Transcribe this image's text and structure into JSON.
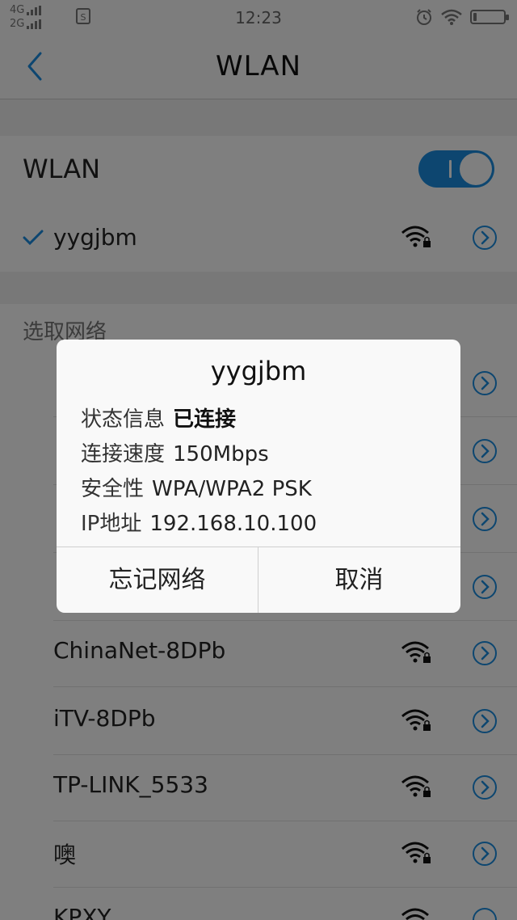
{
  "status_bar": {
    "network_top": "4G",
    "network_bottom": "2G",
    "sim_label": "S",
    "time": "12:23",
    "battery_level_pct": 10,
    "icons": [
      "alarm-icon",
      "wifi-icon",
      "battery-icon"
    ]
  },
  "nav": {
    "title": "WLAN",
    "back_icon": "chevron-left-icon"
  },
  "wlan_toggle": {
    "label": "WLAN",
    "on": true,
    "accent": "#1a8de0"
  },
  "connected": {
    "name": "yygjbm"
  },
  "section_label": "选取网络",
  "networks": [
    {
      "name": "ChinaNet-8DPb"
    },
    {
      "name": "iTV-8DPb"
    },
    {
      "name": "TP-LINK_5533"
    },
    {
      "name": "噢"
    },
    {
      "name": "KPXY"
    }
  ],
  "dialog": {
    "title": "yygjbm",
    "rows": [
      {
        "key": "状态信息",
        "value": "已连接"
      },
      {
        "key": "连接速度",
        "value": "150Mbps"
      },
      {
        "key": "安全性",
        "value": "WPA/WPA2 PSK"
      },
      {
        "key": "IP地址",
        "value": "192.168.10.100"
      }
    ],
    "forget_label": "忘记网络",
    "cancel_label": "取消"
  }
}
